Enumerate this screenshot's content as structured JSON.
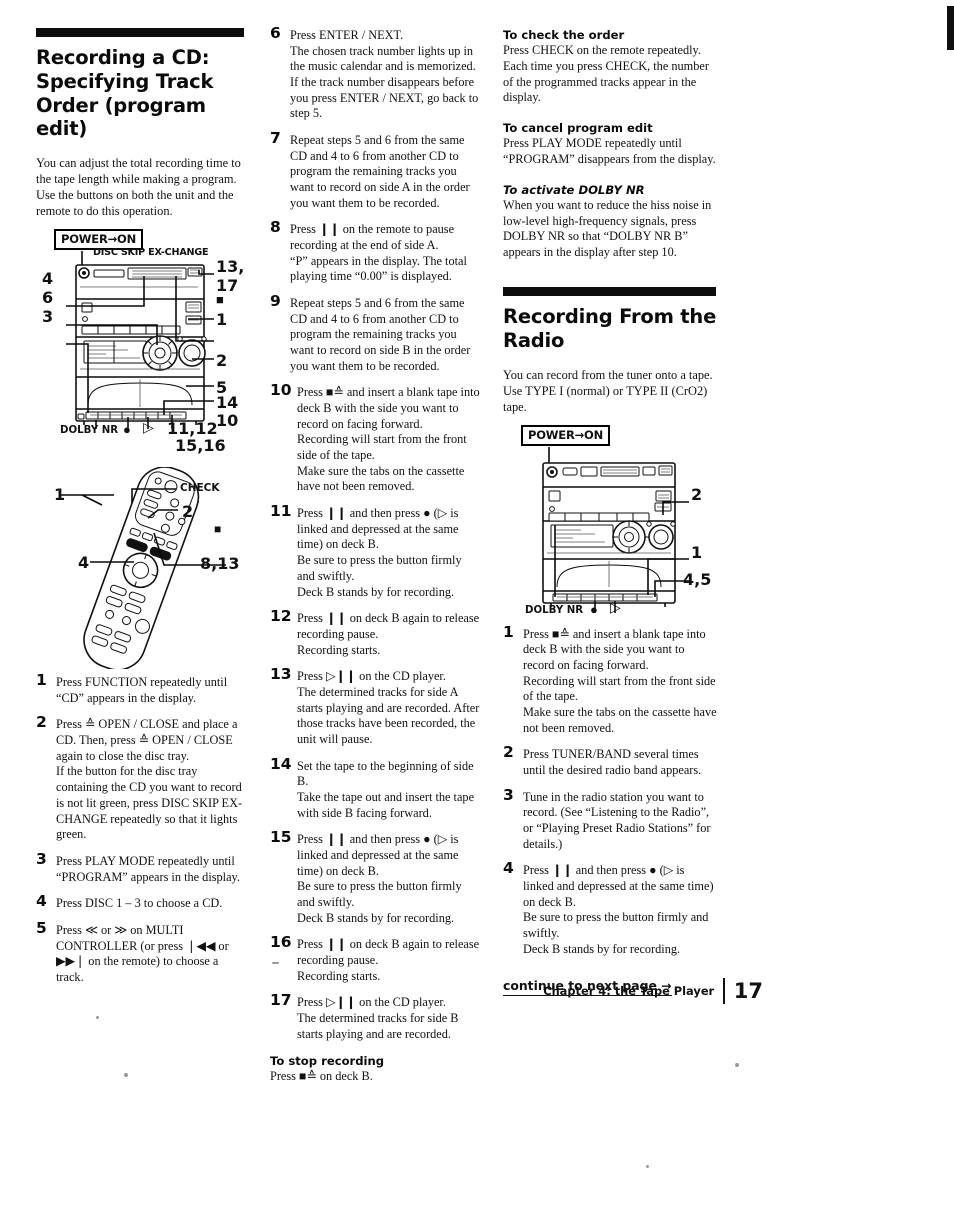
{
  "page": {
    "number": "17",
    "chapter": "Chapter 4: the Tape Player",
    "continue_label": "continue to next page →"
  },
  "section_cd": {
    "title": "Recording a CD: Specifying Track Order (program edit)",
    "lede": "You can adjust the total recording time to the tape length while making a program. Use the buttons on both the unit and the remote to do this operation.",
    "power_label": "POWER→ON",
    "unit_figure": {
      "top_label": "DISC SKIP EX-CHANGE",
      "dolby_label": "DOLBY NR",
      "callouts_left": [
        "4",
        "6",
        "3"
      ],
      "callouts_right": [
        "13,",
        "17",
        "1",
        "2",
        "5",
        "14",
        "10"
      ],
      "callouts_bottom": [
        "11,12",
        "15,16"
      ],
      "record_glyph": "●",
      "play_glyph": "▷",
      "stop_glyph": "■"
    },
    "remote_figure": {
      "check_label": "CHECK",
      "callouts": [
        "1",
        "2",
        "4",
        "8,13"
      ],
      "stop_glyph": "■"
    },
    "steps": [
      {
        "num": "1",
        "lines": [
          "Press FUNCTION repeatedly until “CD” appears in the display."
        ]
      },
      {
        "num": "2",
        "lines": [
          "Press ≙ OPEN / CLOSE and place a CD. Then, press ≙ OPEN / CLOSE again to close the disc tray.",
          "If the button for the disc tray containing the CD you want to record is not lit green, press DISC SKIP EX-CHANGE repeatedly so that it lights green."
        ]
      },
      {
        "num": "3",
        "lines": [
          "Press PLAY MODE repeatedly until “PROGRAM” appears in the display."
        ]
      },
      {
        "num": "4",
        "lines": [
          "Press DISC 1 – 3 to choose a CD."
        ]
      },
      {
        "num": "5",
        "lines": [
          "Press ≪ or ≫ on MULTI CONTROLLER (or press ❘◀◀ or ▶▶❘ on the remote) to choose a track."
        ]
      },
      {
        "num": "6",
        "lines": [
          "Press ENTER / NEXT.",
          "The chosen track number lights up in the music calendar and is memorized. If the track number disappears before you press ENTER / NEXT, go back to step 5."
        ]
      },
      {
        "num": "7",
        "lines": [
          "Repeat steps 5 and 6 from the same CD and 4 to 6 from another CD to program the remaining tracks you want to record on side A in the order you want them to be recorded."
        ]
      },
      {
        "num": "8",
        "lines": [
          "Press ❙❙ on the remote to pause recording at the end of side A.",
          "“P” appears in the display. The total playing time “0.00” is displayed."
        ]
      },
      {
        "num": "9",
        "lines": [
          "Repeat steps 5 and 6 from the same CD and 4 to 6 from another CD to program the remaining tracks you want to record on side B in the order you want them to be recorded."
        ]
      },
      {
        "num": "10",
        "lines": [
          "Press ■≙ and insert a blank tape into deck B with the side you want to record on facing forward.",
          "Recording will start from the front side of the tape.",
          "Make sure the tabs on the cassette have not been removed."
        ]
      },
      {
        "num": "11",
        "lines": [
          "Press ❙❙ and then press ● (▷ is linked and depressed at the same time) on deck B.",
          "Be sure to press the button firmly and swiftly.",
          "Deck B stands by for recording."
        ]
      },
      {
        "num": "12",
        "lines": [
          "Press ❙❙ on deck B again to release recording pause.",
          "Recording starts."
        ]
      },
      {
        "num": "13",
        "lines": [
          "Press ▷❙❙ on the CD player.",
          "The determined tracks for side A starts playing and are recorded.  After those tracks have been recorded, the unit will pause."
        ]
      },
      {
        "num": "14",
        "lines": [
          "Set the tape to the beginning of side B.",
          "Take the tape out and insert the tape with side B facing forward."
        ]
      },
      {
        "num": "15",
        "lines": [
          "Press ❙❙ and then press ● (▷ is linked and depressed at the same time) on deck B.",
          "Be sure to press the button firmly and swiftly.",
          "Deck B stands by for recording."
        ]
      },
      {
        "num": "16",
        "lines": [
          "Press ❙❙ on deck B again to release recording pause.",
          "Recording starts."
        ]
      },
      {
        "num": "17",
        "lines": [
          "Press ▷❙❙ on the CD player.",
          "The determined tracks for side B starts playing and are recorded."
        ]
      }
    ],
    "stop_note": {
      "heading": "To stop recording",
      "body": "Press ■≙ on deck B."
    },
    "notes": [
      {
        "heading": "To check the order",
        "italic": false,
        "body": "Press CHECK on the remote repeatedly. Each time you press CHECK, the number of the programmed tracks appear in the display."
      },
      {
        "heading": "To cancel program edit",
        "italic": false,
        "body": "Press PLAY MODE repeatedly until “PROGRAM” disappears from the display."
      },
      {
        "heading": "To activate DOLBY NR",
        "italic": true,
        "body": "When you want to reduce the hiss noise in low-level high-frequency signals, press DOLBY NR so that “DOLBY NR B” appears in the display after step 10."
      }
    ]
  },
  "section_radio": {
    "title": "Recording From the Radio",
    "lede": "You can record from the tuner onto a tape. Use TYPE I (normal) or  TYPE II (CrO2) tape.",
    "power_label": "POWER→ON",
    "unit_figure": {
      "dolby_label": "DOLBY NR",
      "callouts_right": [
        "2",
        "1",
        "4,5"
      ],
      "record_glyph": "●",
      "play_glyph": "▷"
    },
    "steps": [
      {
        "num": "1",
        "lines": [
          "Press ■≙ and insert a blank tape into deck B with the side you want to record on facing forward.",
          "Recording will start from the front side of the tape.",
          "Make sure the tabs on the cassette have not been removed."
        ]
      },
      {
        "num": "2",
        "lines": [
          "Press TUNER/BAND several times until the desired radio band appears."
        ]
      },
      {
        "num": "3",
        "lines": [
          "Tune in the radio station you want to record. (See “Listening to the Radio”, or “Playing Preset Radio Stations” for details.)"
        ]
      },
      {
        "num": "4",
        "lines": [
          "Press ❙❙ and then press ● (▷ is linked and depressed at the same time) on deck B.",
          "Be sure to press the button firmly and swiftly.",
          "Deck B stands by for recording."
        ]
      }
    ]
  }
}
